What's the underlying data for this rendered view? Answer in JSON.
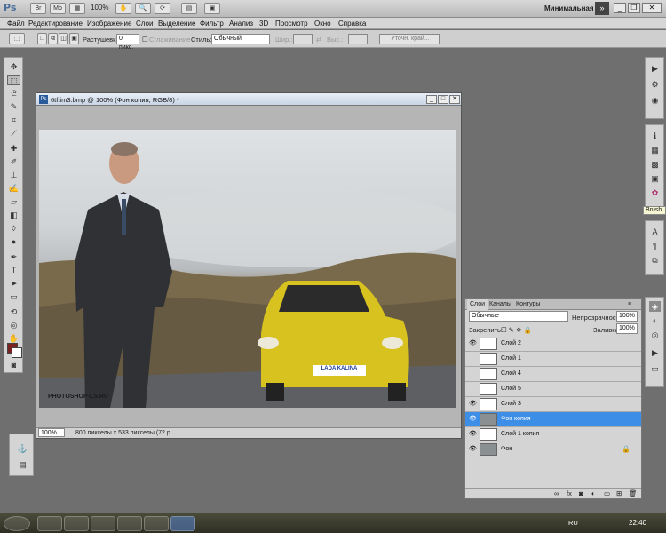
{
  "app": {
    "logo": "Ps",
    "zoom": "100%",
    "workspace": "Минимальная",
    "workspace_arrow": "»"
  },
  "menu": [
    "Файл",
    "Редактирование",
    "Изображение",
    "Слои",
    "Выделение",
    "Фильтр",
    "Анализ",
    "3D",
    "Просмотр",
    "Окно",
    "Справка"
  ],
  "options": {
    "feather_label": "Растушевка:",
    "feather_value": "0 пикс.",
    "antialias_label": "Сглаживание",
    "style_label": "Стиль:",
    "style_value": "Обычный",
    "width_label": "Шир.:",
    "height_label": "Выс.:",
    "refine_label": "Уточн. край..."
  },
  "document": {
    "title": "6tftim3.bmp @ 100% (Фон копия, RGB/8) *",
    "status_zoom": "100%",
    "status_info": "800 пикселы x 533 пикселы (72 p...",
    "watermark": "PHOTOSHOP-LS.RU",
    "plate": "LADA KALINA"
  },
  "tooltip": "Brush",
  "layers_panel": {
    "tabs": [
      "Слои",
      "Каналы",
      "Контуры"
    ],
    "blend": "Обычные",
    "opacity_label": "Непрозрачность:",
    "opacity_value": "100%",
    "lock_label": "Закрепить:",
    "fill_label": "Заливка:",
    "fill_value": "100%",
    "layers": [
      {
        "name": "Слой 2",
        "visible": true,
        "selected": false
      },
      {
        "name": "Слой 1",
        "visible": false,
        "selected": false
      },
      {
        "name": "Слой 4",
        "visible": false,
        "selected": false
      },
      {
        "name": "Слой 5",
        "visible": false,
        "selected": false
      },
      {
        "name": "Слой 3",
        "visible": true,
        "selected": false
      },
      {
        "name": "Фон копия",
        "visible": true,
        "selected": true
      },
      {
        "name": "Слой 1 копия",
        "visible": true,
        "selected": false
      },
      {
        "name": "Фон",
        "visible": true,
        "selected": false
      }
    ]
  },
  "taskbar": {
    "lang": "RU",
    "time": "22:40"
  },
  "colors": {
    "foreground": "#7a2323",
    "background": "#ffffff",
    "selection": "#3d8ee6"
  }
}
